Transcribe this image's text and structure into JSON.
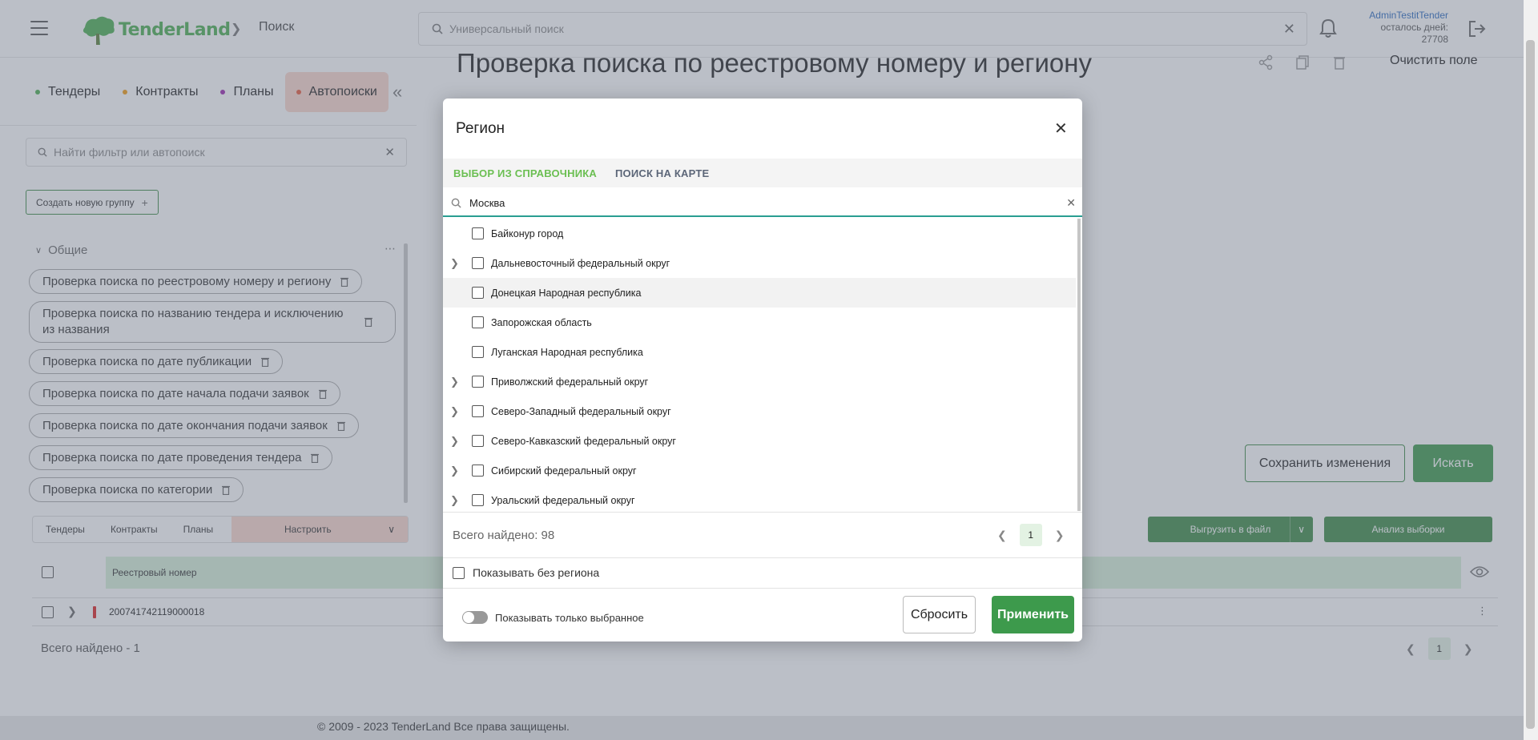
{
  "header": {
    "logo_text": "TenderLand",
    "breadcrumb": "Поиск",
    "search_placeholder": "Универсальный поиск",
    "user_name": "AdminTestitTender",
    "days_left_label": "осталось дней:",
    "days_left_value": "27708"
  },
  "sidebar": {
    "tabs": [
      {
        "label": "Тендеры",
        "color": "#4caf50"
      },
      {
        "label": "Контракты",
        "color": "#f39c12"
      },
      {
        "label": "Планы",
        "color": "#9c27b0"
      },
      {
        "label": "Автопоиски",
        "color": "#e8593b",
        "active": true
      }
    ],
    "filter_search_placeholder": "Найти фильтр или автопоиск",
    "new_group_label": "Создать новую группу",
    "group_title": "Общие",
    "filters": [
      "Проверка поиска по реестровому номеру и региону",
      "Проверка поиска по названию тендера и исключению из названия",
      "Проверка поиска по дате публикации",
      "Проверка поиска по дате начала подачи заявок",
      "Проверка поиска по дате окончания подачи заявок",
      "Проверка поиска по дате проведения тендера",
      "Проверка поиска по категории"
    ]
  },
  "main": {
    "title": "Проверка поиска по реестровому номеру и региону",
    "clear_field": "Очистить поле",
    "save_changes": "Сохранить изменения",
    "search_button": "Искать"
  },
  "results": {
    "tabs": [
      "Тендеры",
      "Контракты",
      "Планы",
      "Настроить"
    ],
    "export_button": "Выгрузить в файл",
    "analysis_button": "Анализ выборки",
    "column_header": "Реестровый номер",
    "rows": [
      {
        "number": "200741742119000018"
      }
    ],
    "total": "Всего найдено - 1",
    "page": "1"
  },
  "footer": {
    "copyright": "© 2009 - 2023 TenderLand Все права защищены."
  },
  "modal": {
    "title": "Регион",
    "tabs": {
      "directory": "ВЫБОР ИЗ СПРАВОЧНИКА",
      "map": "ПОИСК НА КАРТЕ"
    },
    "search_value": "Москва",
    "regions": [
      {
        "name": "Байконур город",
        "expandable": false
      },
      {
        "name": "Дальневосточный федеральный округ",
        "expandable": true
      },
      {
        "name": "Донецкая Народная республика",
        "expandable": false,
        "highlighted": true
      },
      {
        "name": "Запорожская область",
        "expandable": false
      },
      {
        "name": "Луганская Народная республика",
        "expandable": false
      },
      {
        "name": "Приволжский федеральный округ",
        "expandable": true
      },
      {
        "name": "Северо-Западный федеральный округ",
        "expandable": true
      },
      {
        "name": "Северо-Кавказский федеральный округ",
        "expandable": true
      },
      {
        "name": "Сибирский федеральный округ",
        "expandable": true
      },
      {
        "name": "Уральский федеральный округ",
        "expandable": true
      }
    ],
    "total": "Всего найдено: 98",
    "page": "1",
    "show_without_region": "Показывать без региона",
    "show_only_selected": "Показывать только выбранное",
    "reset_button": "Сбросить",
    "apply_button": "Применить"
  }
}
